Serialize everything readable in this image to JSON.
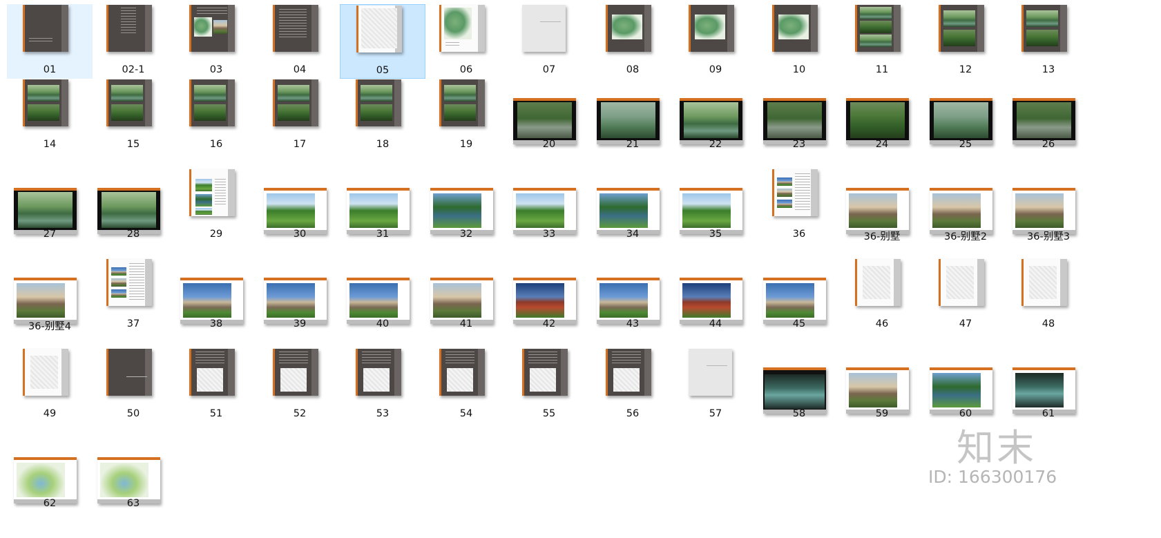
{
  "files": [
    {
      "label": "01",
      "kind": "dark-title",
      "state": "hot"
    },
    {
      "label": "02-1",
      "kind": "dark-toc"
    },
    {
      "label": "03",
      "kind": "dark-collage"
    },
    {
      "label": "04",
      "kind": "dark-text"
    },
    {
      "label": "05",
      "kind": "white-plan",
      "state": "selected"
    },
    {
      "label": "06",
      "kind": "white-map"
    },
    {
      "label": "07",
      "kind": "grey-cover"
    },
    {
      "label": "08",
      "kind": "dark-map"
    },
    {
      "label": "09",
      "kind": "dark-map"
    },
    {
      "label": "10",
      "kind": "dark-map"
    },
    {
      "label": "11",
      "kind": "dark-photos3"
    },
    {
      "label": "12",
      "kind": "dark-photos2"
    },
    {
      "label": "13",
      "kind": "dark-photos2"
    },
    {
      "label": "14",
      "kind": "dark-photos2"
    },
    {
      "label": "15",
      "kind": "dark-photos2"
    },
    {
      "label": "16",
      "kind": "dark-photos2"
    },
    {
      "label": "17",
      "kind": "dark-photos2"
    },
    {
      "label": "18",
      "kind": "dark-photos2"
    },
    {
      "label": "19",
      "kind": "dark-photos2"
    },
    {
      "label": "20",
      "kind": "slide-photo",
      "tone": "road"
    },
    {
      "label": "21",
      "kind": "slide-photo",
      "tone": "mist"
    },
    {
      "label": "22",
      "kind": "slide-photo",
      "tone": "lake"
    },
    {
      "label": "23",
      "kind": "slide-photo",
      "tone": "road"
    },
    {
      "label": "24",
      "kind": "slide-photo",
      "tone": "forest"
    },
    {
      "label": "25",
      "kind": "slide-photo",
      "tone": "mist"
    },
    {
      "label": "26",
      "kind": "slide-photo",
      "tone": "road"
    },
    {
      "label": "27",
      "kind": "slide-photo",
      "tone": "lake"
    },
    {
      "label": "28",
      "kind": "slide-photo",
      "tone": "lake"
    },
    {
      "label": "29",
      "kind": "white-photos3"
    },
    {
      "label": "30",
      "kind": "slide-white",
      "tone": "golf"
    },
    {
      "label": "31",
      "kind": "slide-white",
      "tone": "golf"
    },
    {
      "label": "32",
      "kind": "slide-white",
      "tone": "pond"
    },
    {
      "label": "33",
      "kind": "slide-white",
      "tone": "golf"
    },
    {
      "label": "34",
      "kind": "slide-white",
      "tone": "pond"
    },
    {
      "label": "35",
      "kind": "slide-white",
      "tone": "golf"
    },
    {
      "label": "36",
      "kind": "white-photos4"
    },
    {
      "label": "36-别墅",
      "kind": "slide-white",
      "tone": "villa"
    },
    {
      "label": "36-别墅2",
      "kind": "slide-white",
      "tone": "villa"
    },
    {
      "label": "36-别墅3",
      "kind": "slide-white",
      "tone": "villa"
    },
    {
      "label": "36-别墅4",
      "kind": "slide-white",
      "tone": "villa"
    },
    {
      "label": "37",
      "kind": "white-photos4"
    },
    {
      "label": "38",
      "kind": "slide-white",
      "tone": "house"
    },
    {
      "label": "39",
      "kind": "slide-white",
      "tone": "house"
    },
    {
      "label": "40",
      "kind": "slide-white",
      "tone": "house"
    },
    {
      "label": "41",
      "kind": "slide-white",
      "tone": "villa"
    },
    {
      "label": "42",
      "kind": "slide-white",
      "tone": "house2"
    },
    {
      "label": "43",
      "kind": "slide-white",
      "tone": "house"
    },
    {
      "label": "44",
      "kind": "slide-white",
      "tone": "house2"
    },
    {
      "label": "45",
      "kind": "slide-white",
      "tone": "house"
    },
    {
      "label": "46",
      "kind": "white-floorplan"
    },
    {
      "label": "47",
      "kind": "white-floorplan"
    },
    {
      "label": "48",
      "kind": "white-floorplan"
    },
    {
      "label": "49",
      "kind": "white-floorplan"
    },
    {
      "label": "50",
      "kind": "dark-cover"
    },
    {
      "label": "51",
      "kind": "dark-textplan"
    },
    {
      "label": "52",
      "kind": "dark-textplan"
    },
    {
      "label": "53",
      "kind": "dark-textplan"
    },
    {
      "label": "54",
      "kind": "dark-textplan"
    },
    {
      "label": "55",
      "kind": "dark-textplan"
    },
    {
      "label": "56",
      "kind": "dark-textplan"
    },
    {
      "label": "57",
      "kind": "grey-cover"
    },
    {
      "label": "58",
      "kind": "slide-dark",
      "tone": "aerial"
    },
    {
      "label": "59",
      "kind": "slide-white",
      "tone": "villa"
    },
    {
      "label": "60",
      "kind": "slide-white",
      "tone": "pond"
    },
    {
      "label": "61",
      "kind": "slide-white",
      "tone": "aerial"
    },
    {
      "label": "62",
      "kind": "slide-white",
      "tone": "sketch"
    },
    {
      "label": "63",
      "kind": "slide-white",
      "tone": "sketch"
    }
  ],
  "watermark": {
    "logo": "知末",
    "id": "ID: 166300176"
  }
}
